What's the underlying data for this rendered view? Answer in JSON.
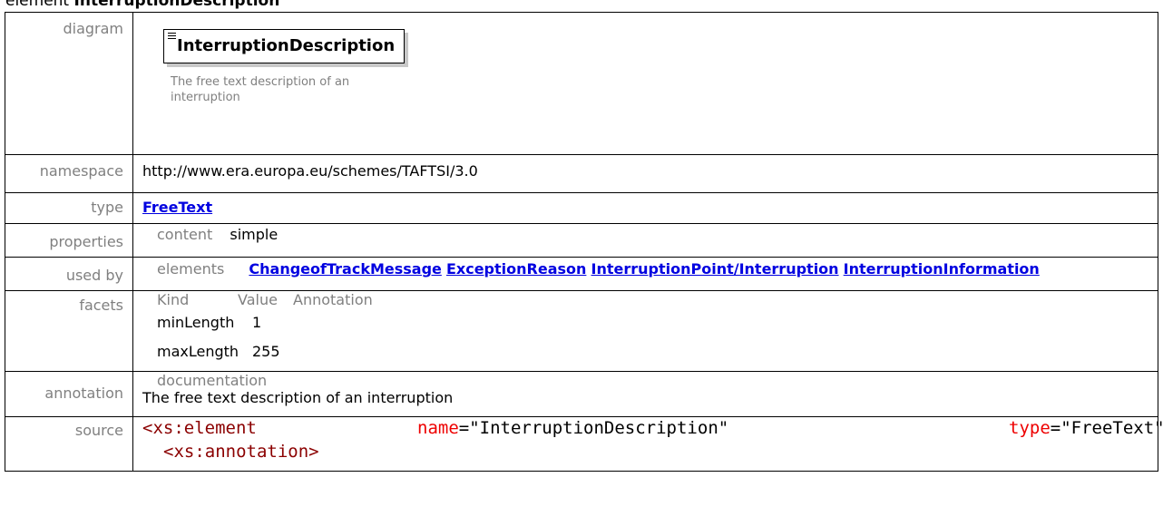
{
  "title": {
    "prefix": "element",
    "name": "InterruptionDescription"
  },
  "rows": {
    "diagram": {
      "label": "diagram",
      "element_name": "InterruptionDescription",
      "doc": "The free text description of an interruption"
    },
    "namespace": {
      "label": "namespace",
      "value": "http://www.era.europa.eu/schemes/TAFTSI/3.0"
    },
    "type": {
      "label": "type",
      "value": "FreeText"
    },
    "properties": {
      "label": "properties",
      "key": "content",
      "value": "simple"
    },
    "used_by": {
      "label": "used by",
      "key": "elements",
      "items": [
        "ChangeofTrackMessage",
        "ExceptionReason",
        "InterruptionPoint/Interruption",
        "InterruptionInformation"
      ]
    },
    "facets": {
      "label": "facets",
      "headers": [
        "Kind",
        "Value",
        "Annotation"
      ],
      "rows": [
        {
          "kind": "minLength",
          "value": "1"
        },
        {
          "kind": "maxLength",
          "value": "255"
        }
      ]
    },
    "annotation": {
      "label": "annotation",
      "key": "documentation",
      "value": "The free text description of an interruption"
    },
    "source": {
      "label": "source",
      "line1": {
        "tag": "<xs:element",
        "attr1": "name",
        "eq1": "=",
        "val1": "\"InterruptionDescription\"",
        "attr2": "type",
        "eq2": "=",
        "val2": "\"FreeText\"",
        "close": ">"
      },
      "line2": {
        "tag": "<xs:annotation>"
      }
    }
  }
}
